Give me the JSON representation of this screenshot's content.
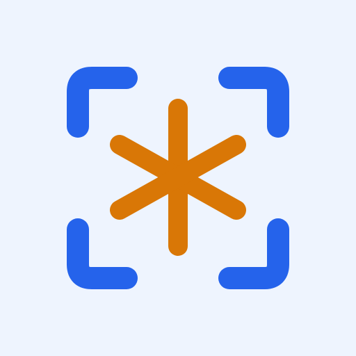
{
  "colors": {
    "background": "#eef4fe",
    "frame": "#2563eb",
    "asterisk": "#d97706"
  },
  "icon": {
    "name": "asterisk-scan-icon",
    "parts": [
      "scan-frame-corners",
      "asterisk"
    ]
  }
}
